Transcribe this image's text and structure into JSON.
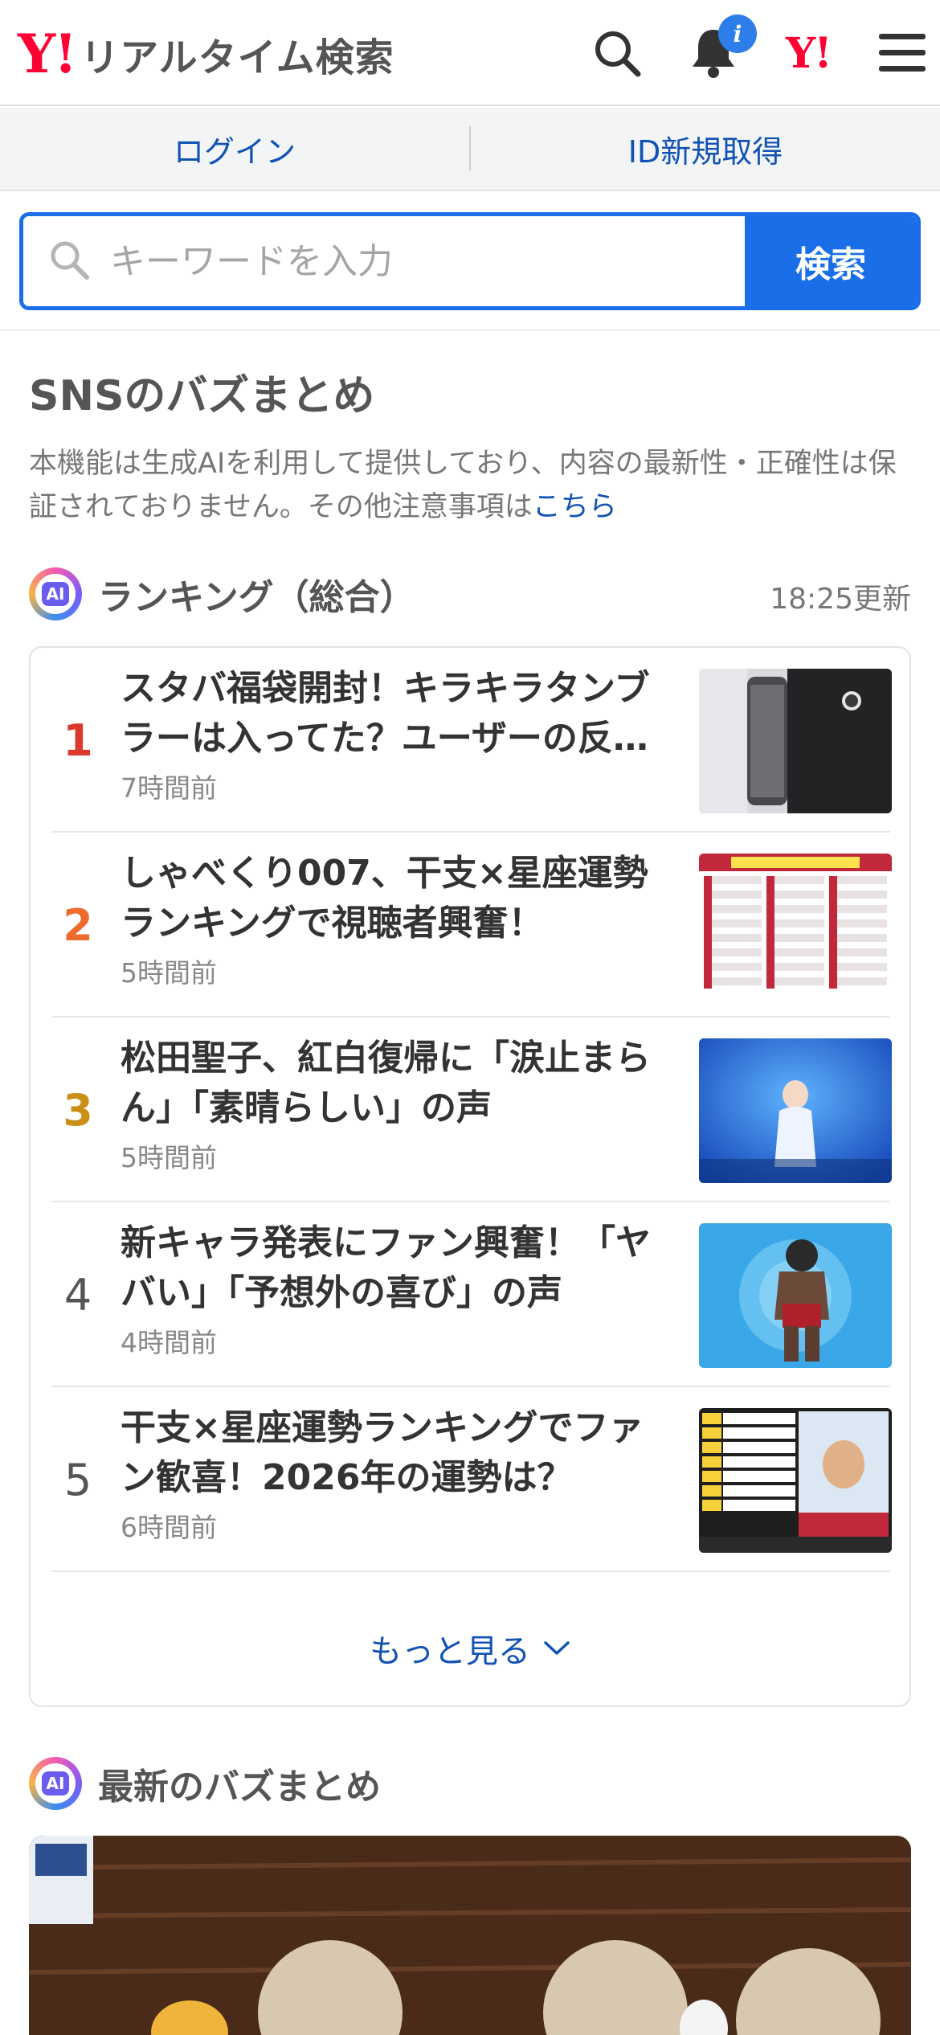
{
  "header": {
    "logo_mark": "Y!",
    "logo_text": "リアルタイム検索",
    "notification_badge": "i",
    "yahoo_mark": "Y!"
  },
  "loginbar": {
    "login": "ログイン",
    "register": "ID新規取得"
  },
  "search": {
    "placeholder": "キーワードを入力",
    "button": "検索"
  },
  "sns": {
    "title": "SNSのバズまとめ",
    "notice": "本機能は生成AIを利用して提供しており、内容の最新性・正確性は保証されておりません。その他注意事項は",
    "notice_link": "こちら"
  },
  "ranking": {
    "ai_badge": "AI",
    "title": "ランキング（総合）",
    "updated": "18:25更新",
    "items": [
      {
        "rank": "1",
        "title": "スタバ福袋開封！キラキラタンブラーは入ってた？ユーザーの反…",
        "time": "7時間前",
        "rank_color": "#d93a2b"
      },
      {
        "rank": "2",
        "title": "しゃべくり007、干支×星座運勢ランキングで視聴者興奮！",
        "time": "5時間前",
        "rank_color": "#ef6a2d"
      },
      {
        "rank": "3",
        "title": "松田聖子、紅白復帰に「涙止まらん」「素晴らしい」の声",
        "time": "5時間前",
        "rank_color": "#c98f17"
      },
      {
        "rank": "4",
        "title": "新キャラ発表にファン興奮！「ヤバい」「予想外の喜び」の声",
        "time": "4時間前",
        "rank_color": "#555555"
      },
      {
        "rank": "5",
        "title": "干支×星座運勢ランキングでファン歓喜！2026年の運勢は？",
        "time": "6時間前",
        "rank_color": "#555555"
      }
    ],
    "more": "もっと見る"
  },
  "latest": {
    "ai_badge": "AI",
    "title": "最新のバズまとめ"
  },
  "colors": {
    "accent": "#1a6fe8",
    "link": "#1153b4",
    "brand": "#ff0033"
  }
}
